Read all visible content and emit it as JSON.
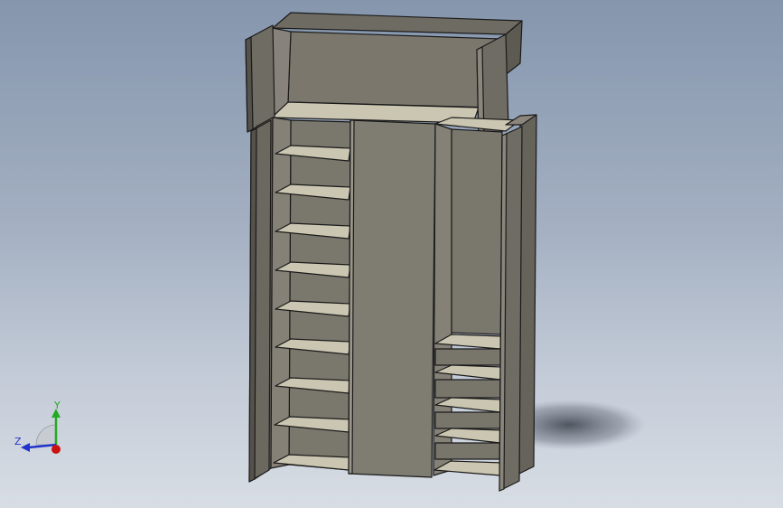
{
  "viewport": {
    "background_top": "#8596ad",
    "background_bottom": "#d8dde4"
  },
  "model": {
    "name": "wardrobe-cabinet",
    "panel_color": "#7a776d",
    "panel_dark": "#66635a",
    "shelf_color": "#cbc6b1",
    "edge_color": "#1a1a1a"
  },
  "triad": {
    "y_label": "Y",
    "z_label": "Z",
    "y_color": "#22aa22",
    "z_color": "#2233cc",
    "x_color": "#cc1111"
  }
}
